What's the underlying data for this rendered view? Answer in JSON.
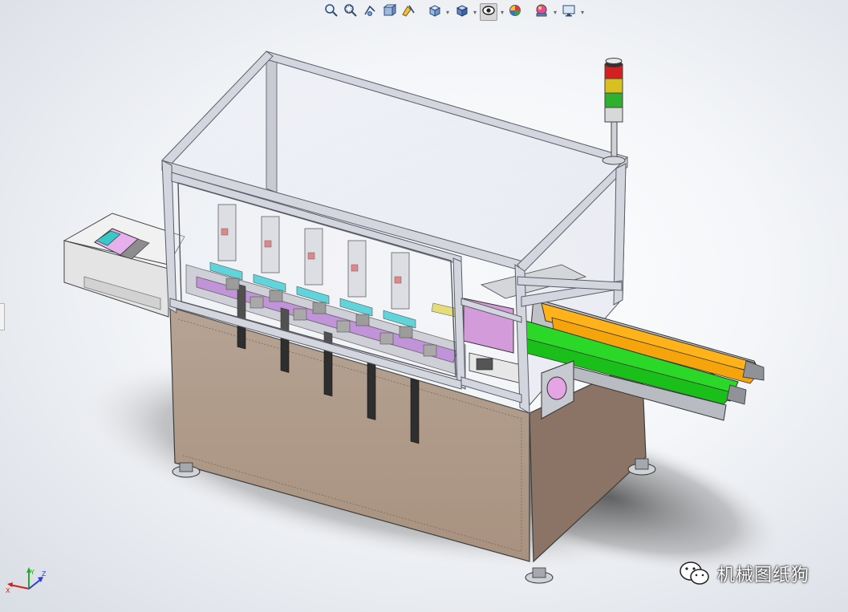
{
  "toolbar": {
    "tools": [
      {
        "name": "zoom-to-fit"
      },
      {
        "name": "zoom-to-area"
      },
      {
        "name": "previous-view"
      },
      {
        "name": "section-view"
      },
      {
        "name": "dynamic-annotation-views"
      },
      {
        "name": "view-orientation",
        "dropdown": true
      },
      {
        "name": "display-style",
        "dropdown": true
      },
      {
        "name": "hide-show-items",
        "dropdown": true,
        "active": true
      },
      {
        "name": "edit-appearance"
      },
      {
        "name": "apply-scene",
        "dropdown": true
      },
      {
        "name": "view-settings",
        "dropdown": true
      }
    ]
  },
  "triad": {
    "x": "X",
    "y": "Y",
    "z": "Z"
  },
  "watermark": {
    "text": "机械图纸狗"
  },
  "colors": {
    "frame": "#c9ccd6",
    "cabinet": "#b09c8a",
    "cabinet_side": "#8a7264",
    "belt_green": "#22d21e",
    "belt_orange": "#ffb21a",
    "magenta_part": "#e29ee6",
    "cyan_plate": "#40d0d6",
    "beacon_red": "#d42020",
    "beacon_yellow": "#d8c020",
    "beacon_green": "#2fb02f"
  }
}
